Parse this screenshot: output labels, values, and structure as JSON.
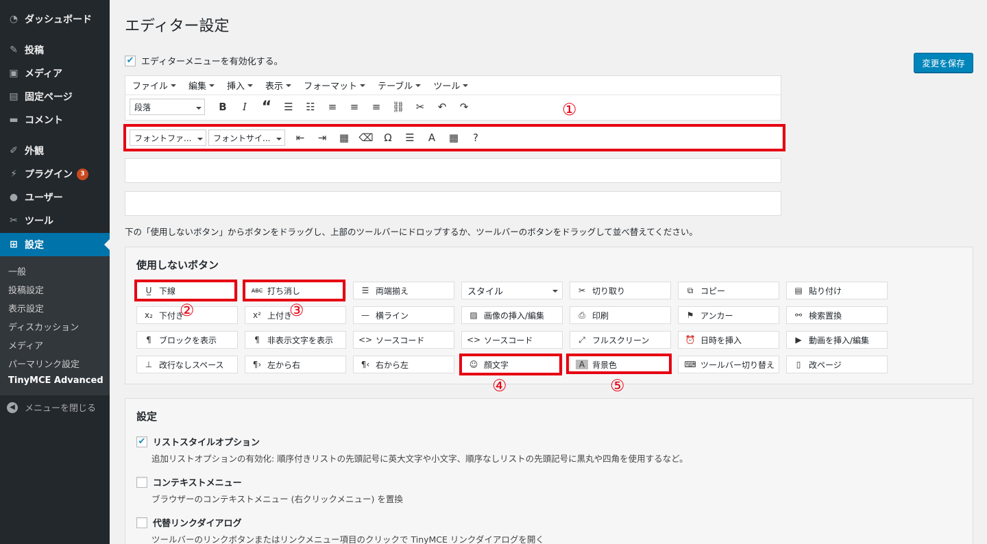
{
  "sidebar": {
    "items": [
      {
        "icon": "dashboard-icon",
        "glyph": "◔",
        "label": "ダッシュボード"
      },
      {
        "icon": "pin-icon",
        "glyph": "✎",
        "label": "投稿"
      },
      {
        "icon": "media-icon",
        "glyph": "▣",
        "label": "メディア"
      },
      {
        "icon": "page-icon",
        "glyph": "▤",
        "label": "固定ページ"
      },
      {
        "icon": "comment-icon",
        "glyph": "▬",
        "label": "コメント"
      },
      {
        "icon": "appearance-icon",
        "glyph": "✐",
        "label": "外観"
      },
      {
        "icon": "plugin-icon",
        "glyph": "⚡",
        "label": "プラグイン",
        "badge": "3"
      },
      {
        "icon": "users-icon",
        "glyph": "●",
        "label": "ユーザー"
      },
      {
        "icon": "tools-icon",
        "glyph": "✂",
        "label": "ツール"
      },
      {
        "icon": "settings-icon",
        "glyph": "⊞",
        "label": "設定"
      }
    ],
    "submenu": [
      "一般",
      "投稿設定",
      "表示設定",
      "ディスカッション",
      "メディア",
      "パーマリンク設定",
      "TinyMCE Advanced"
    ],
    "collapse": "メニューを閉じる"
  },
  "page": {
    "title": "エディター設定",
    "enable_label": "エディターメニューを有効化する。",
    "save": "変更を保存",
    "hint": "下の「使用しないボタン」からボタンをドラッグし、上部のツールバーにドロップするか、ツールバーのボタンをドラッグして並べ替えてください。"
  },
  "editor": {
    "menus": [
      "ファイル",
      "編集",
      "挿入",
      "表示",
      "フォーマット",
      "テーブル",
      "ツール"
    ],
    "format_select": "段落",
    "font_family": "フォントファ...",
    "font_size": "フォントサイ..."
  },
  "unused": {
    "title": "使用しないボタン",
    "buttons": [
      [
        "下線",
        "打ち消し",
        "両端揃え",
        "スタイル",
        "切り取り",
        "コピー",
        "貼り付け"
      ],
      [
        "下付き",
        "上付き",
        "横ライン",
        "画像の挿入/編集",
        "印刷",
        "アンカー",
        "検索置換"
      ],
      [
        "ブロックを表示",
        "非表示文字を表示",
        "ソースコード",
        "ソースコード",
        "フルスクリーン",
        "日時を挿入",
        "動画を挿入/編集"
      ],
      [
        "改行なしスペース",
        "左から右",
        "右から左",
        "顔文字",
        "背景色",
        "ツールバー切り替え",
        "改ページ"
      ]
    ]
  },
  "annotations": [
    "①",
    "②",
    "③",
    "④",
    "⑤"
  ],
  "settings": {
    "title": "設定",
    "options": [
      {
        "label": "リストスタイルオプション",
        "checked": true,
        "desc": "追加リストオプションの有効化: 順序付きリストの先頭記号に英大文字や小文字、順序なしリストの先頭記号に黒丸や四角を使用するなど。"
      },
      {
        "label": "コンテキストメニュー",
        "checked": false,
        "desc": "ブラウザーのコンテキストメニュー (右クリックメニュー) を置換"
      },
      {
        "label": "代替リンクダイアログ",
        "checked": false,
        "desc": "ツールバーのリンクボタンまたはリンクメニュー項目のクリックで TinyMCE リンクダイアログを開く"
      }
    ]
  },
  "colors": {
    "accent": "#0073aa",
    "highlight": "#e60012",
    "sidebar": "#23282d"
  }
}
